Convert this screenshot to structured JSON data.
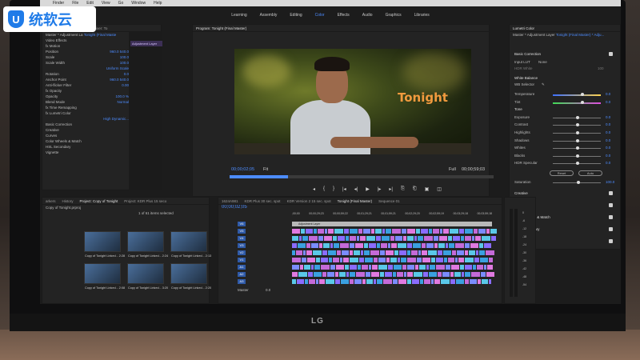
{
  "watermark": {
    "logo_glyph": "U",
    "text": "统软云",
    "color": "#1f7be8"
  },
  "mac_menu": [
    "Finder",
    "File",
    "Edit",
    "View",
    "Go",
    "Window",
    "Help"
  ],
  "workspaces": {
    "items": [
      "Learning",
      "Assembly",
      "Editing",
      "Color",
      "Effects",
      "Audio",
      "Graphics",
      "Libraries"
    ],
    "active": "Color"
  },
  "effect_controls": {
    "tabs": [
      "Effect Controls",
      "Audio Clip Mixer: To"
    ],
    "source": "Master * Adjustment La",
    "sequence": "Tonight (Final Maste",
    "clip_label": "Adjustment Layer",
    "rows": [
      {
        "label": "Video Effects",
        "value": ""
      },
      {
        "label": "fx  Motion",
        "value": ""
      },
      {
        "label": "Position",
        "value": "960.0   540.0"
      },
      {
        "label": "Scale",
        "value": "100.0"
      },
      {
        "label": "Scale Width",
        "value": "100.0"
      },
      {
        "label": "",
        "value": "Uniform Scale"
      },
      {
        "label": "Rotation",
        "value": "0.0"
      },
      {
        "label": "Anchor Point",
        "value": "960.0   540.0"
      },
      {
        "label": "Anti-flicker Filter",
        "value": "0.00"
      },
      {
        "label": "fx  Opacity",
        "value": ""
      },
      {
        "label": "Opacity",
        "value": "100.0 %"
      },
      {
        "label": "Blend Mode",
        "value": "Normal"
      },
      {
        "label": "fx  Time Remapping",
        "value": ""
      },
      {
        "label": "fx  Lumetri Color",
        "value": ""
      },
      {
        "label": "",
        "value": "High Dynamic..."
      },
      {
        "label": "Basic Correction",
        "value": ""
      },
      {
        "label": "Creative",
        "value": ""
      },
      {
        "label": "Curves",
        "value": ""
      },
      {
        "label": "Color Wheels & Match",
        "value": ""
      },
      {
        "label": "HSL Secondary",
        "value": ""
      },
      {
        "label": "Vignette",
        "value": ""
      }
    ]
  },
  "program_monitor": {
    "tab": "Program: Tonight (Final Master)",
    "overlay_title": "Tonight",
    "timecode_current": "00;00;02;05",
    "timecode_duration": "00;00;59;03",
    "zoom": "Fit",
    "quality": "Full",
    "playhead_progress": 0.22,
    "transport": [
      "◂",
      "{",
      "}",
      "|◂",
      "◂|",
      "▶",
      "|▸",
      "▸|",
      "⎘",
      "⎗",
      "▣",
      "◫"
    ]
  },
  "lumetri": {
    "tab": "Lumetri Color",
    "source": "Master * Adjustment Layer",
    "sequence": "Tonight (Final Master) * Adju...",
    "basic_correction": "Basic Correction",
    "input_lut_label": "Input LUT",
    "input_lut_value": "None",
    "hdr_white_label": "HDR White",
    "hdr_white_value": "100",
    "white_balance": "White Balance",
    "wb_selector": "WB Selector",
    "sliders": [
      {
        "label": "Temperature",
        "value": "0.0",
        "pos": 0.6
      },
      {
        "label": "Tint",
        "value": "0.0",
        "pos": 0.6
      },
      {
        "label": "Tone",
        "value": "",
        "pos": null
      },
      {
        "label": "Exposure",
        "value": "0.0",
        "pos": 0.5
      },
      {
        "label": "Contrast",
        "value": "0.0",
        "pos": 0.5
      },
      {
        "label": "Highlights",
        "value": "0.0",
        "pos": 0.5
      },
      {
        "label": "Shadows",
        "value": "0.0",
        "pos": 0.5
      },
      {
        "label": "Whites",
        "value": "0.0",
        "pos": 0.5
      },
      {
        "label": "Blacks",
        "value": "0.0",
        "pos": 0.5
      },
      {
        "label": "HDR Specular",
        "value": "0.0",
        "pos": 0.5
      }
    ],
    "reset_label": "Reset",
    "auto_label": "Auto",
    "saturation_label": "Saturation",
    "saturation_value": "100.0",
    "sections": [
      "Creative",
      "Curves",
      "Color Wheels & Match",
      "HSL Secondary",
      "Vignette"
    ]
  },
  "project_panel": {
    "tabs": [
      "arkers",
      "History",
      "Project: Copy of Tonight",
      "Project: KDR Plus 15 seco"
    ],
    "project_name": "Copy of Tonight.prproj",
    "selection": "1 of 61 items selected",
    "items": [
      {
        "name": "Copy of Tonight Linked...",
        "dur": "2:28"
      },
      {
        "name": "Copy of Tonight Linked...",
        "dur": "2:24"
      },
      {
        "name": "Copy of Tonight Linked...",
        "dur": "2:13"
      },
      {
        "name": "Copy of Tonight Linked...",
        "dur": "2:08"
      },
      {
        "name": "Copy of Tonight Linked...",
        "dur": "3:20"
      },
      {
        "name": "Copy of Tonight Linked...",
        "dur": "2:20"
      }
    ]
  },
  "timeline": {
    "tabs": [
      "1624A981",
      "KDR Plus 30 sec. spot",
      "KDR Version 2 15 sec. spot",
      "Tonight (Final Master)",
      "Sequence 01"
    ],
    "active_tab": "Tonight (Final Master)",
    "timecode": "00;00;02;05",
    "ruler": [
      ";00;00",
      "00;00;29;23",
      "00;00;59;22",
      "00;01;29;21",
      "00;01;59;21",
      "00;02;29;20",
      "00;02;59;19",
      "00;03;29;18",
      "00;03;59;18"
    ],
    "clip_label": "Adjustment Layer",
    "tracks_video": [
      "V6",
      "V5",
      "V4",
      "V3",
      "V2",
      "V1"
    ],
    "tracks_audio": [
      "A1",
      "A2",
      "A3"
    ],
    "master_label": "Master",
    "master_value": "0.0"
  },
  "meters": {
    "scale": [
      "0",
      "-6",
      "-12",
      "-18",
      "-24",
      "-30",
      "-36",
      "-42",
      "-48",
      "-54"
    ],
    "footer": [
      "S",
      "S"
    ]
  },
  "monitor_brand": "LG"
}
